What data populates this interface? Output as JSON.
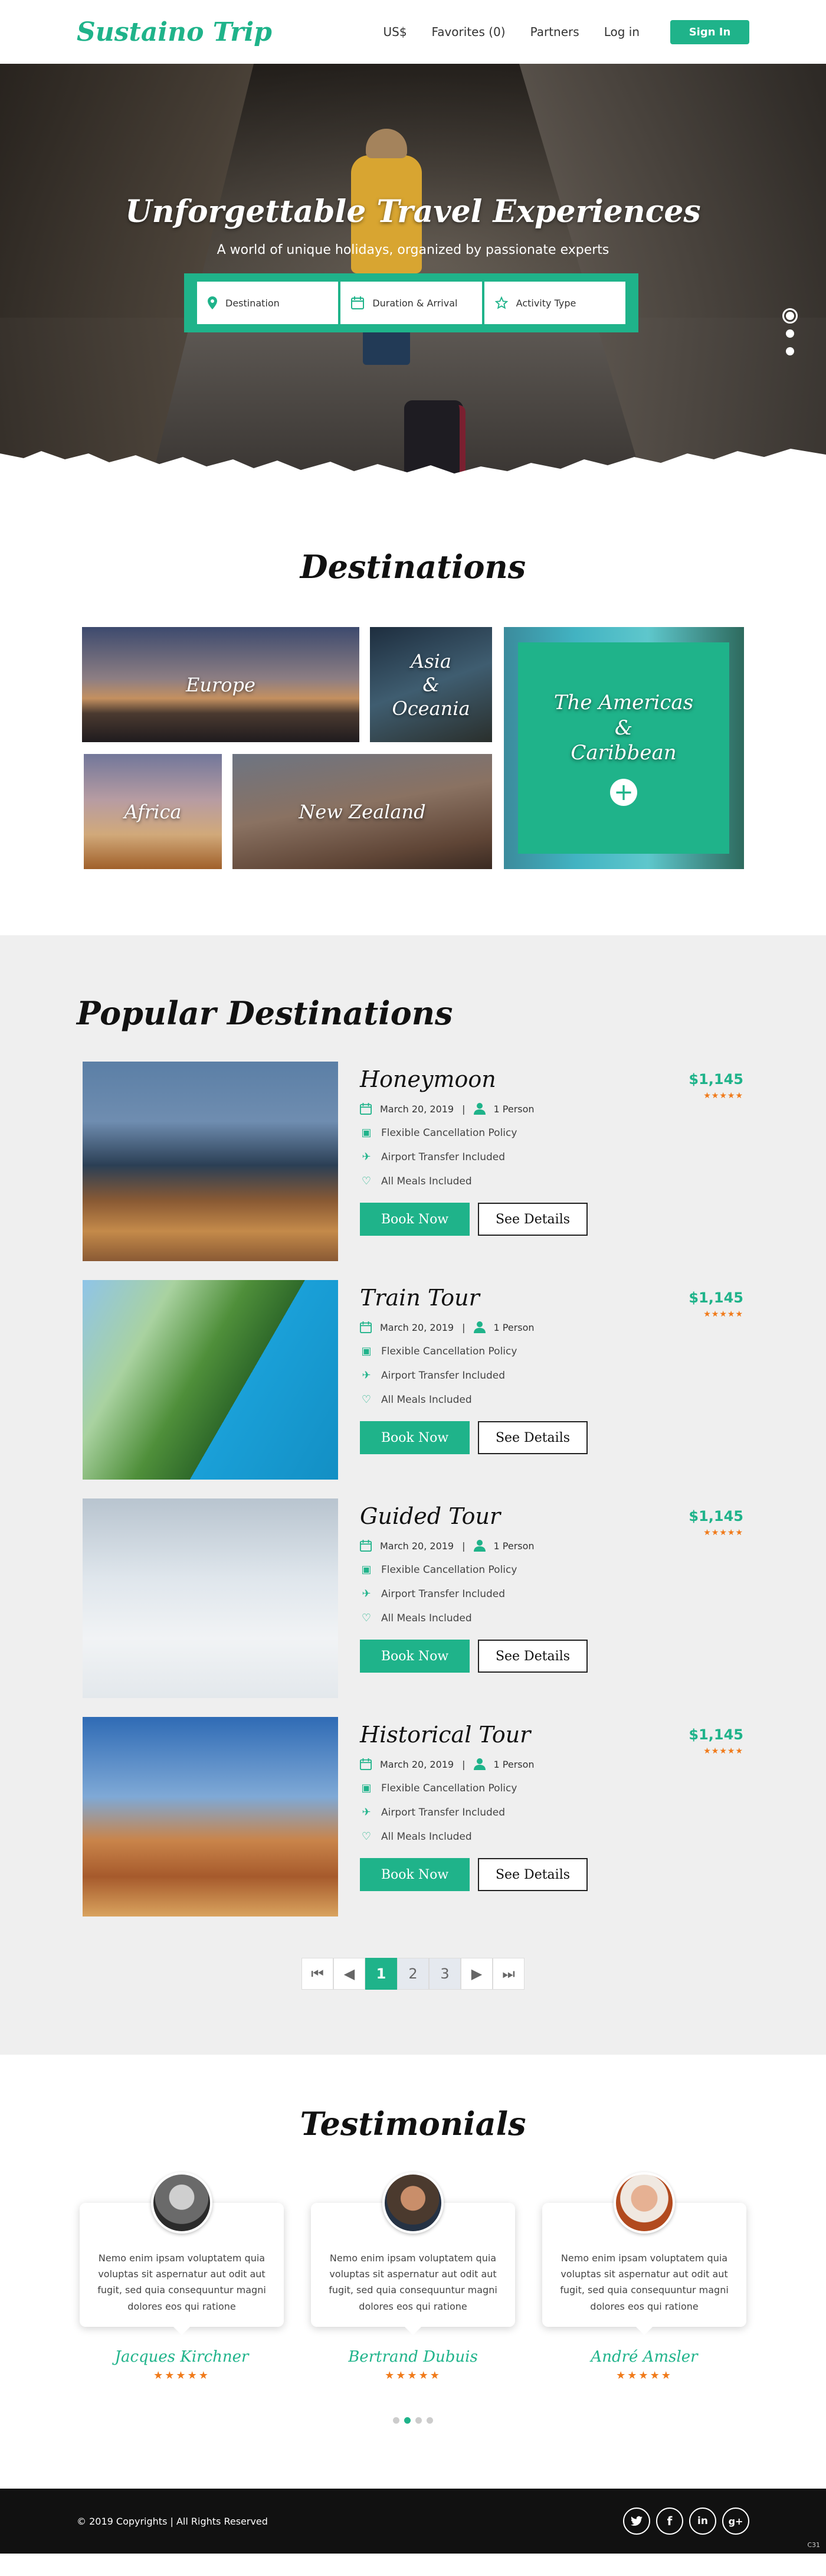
{
  "header": {
    "logo": "Sustaino Trip",
    "nav": [
      "US$",
      "Favorites (0)",
      "Partners",
      "Log in"
    ],
    "signin": "Sign In"
  },
  "hero": {
    "title": "Unforgettable Travel Experiences",
    "subtitle": "A world of unique holidays, organized by passionate experts",
    "search": {
      "destination": "Destination",
      "duration": "Duration & Arrival",
      "activity": "Activity Type"
    },
    "slides": 3,
    "active_slide": 1
  },
  "destinations": {
    "title": "Destinations",
    "tiles": {
      "europe": "Europe",
      "asia": "Asia\n&\nOceania",
      "africa": "Africa",
      "nz": "New Zealand",
      "americas": "The Americas\n&\nCaribbean",
      "plus": "+"
    }
  },
  "popular": {
    "title": "Popular Destinations",
    "tours": [
      {
        "name": "Honeymoon",
        "price": "$1,145",
        "rating": 5,
        "date": "March 20, 2019",
        "people": "1 Person",
        "features": [
          "Flexible Cancellation Policy",
          "Airport Transfer Included",
          "All Meals Included"
        ],
        "book": "Book Now",
        "details": "See Details"
      },
      {
        "name": "Train Tour",
        "price": "$1,145",
        "rating": 5,
        "date": "March 20, 2019",
        "people": "1 Person",
        "features": [
          "Flexible Cancellation Policy",
          "Airport Transfer Included",
          "All Meals Included"
        ],
        "book": "Book Now",
        "details": "See Details"
      },
      {
        "name": "Guided Tour",
        "price": "$1,145",
        "rating": 5,
        "date": "March 20, 2019",
        "people": "1 Person",
        "features": [
          "Flexible Cancellation Policy",
          "Airport Transfer Included",
          "All Meals Included"
        ],
        "book": "Book Now",
        "details": "See Details"
      },
      {
        "name": "Historical Tour",
        "price": "$1,145",
        "rating": 5,
        "date": "March 20, 2019",
        "people": "1 Person",
        "features": [
          "Flexible Cancellation Policy",
          "Airport Transfer Included",
          "All Meals Included"
        ],
        "book": "Book Now",
        "details": "See Details"
      }
    ],
    "pagination": {
      "pages": [
        "1",
        "2",
        "3"
      ],
      "current": "1"
    }
  },
  "testimonials": {
    "title": "Testimonials",
    "items": [
      {
        "name": "Jacques Kirchner",
        "rating": 5,
        "text": "Nemo enim ipsam voluptatem quia voluptas sit aspernatur aut odit aut fugit, sed quia consequuntur magni dolores eos qui ratione"
      },
      {
        "name": "Bertrand Dubuis",
        "rating": 5,
        "text": "Nemo enim ipsam voluptatem quia voluptas sit aspernatur aut odit aut fugit, sed quia consequuntur magni dolores eos qui ratione"
      },
      {
        "name": "André Amsler",
        "rating": 5,
        "text": "Nemo enim ipsam voluptatem quia voluptas sit aspernatur aut odit aut fugit, sed quia consequuntur magni dolores eos qui ratione"
      }
    ],
    "slides": 4,
    "active_slide": 2
  },
  "footer": {
    "copyright": "© 2019 Copyrights | All Rights Reserved",
    "socials": [
      "twitter-icon",
      "facebook-icon",
      "linkedin-icon",
      "googleplus-icon"
    ],
    "corner": "C31"
  },
  "colors": {
    "accent": "#1fb38a",
    "star": "#f07a1a",
    "footer": "#111111",
    "section_gray": "#efefef"
  }
}
